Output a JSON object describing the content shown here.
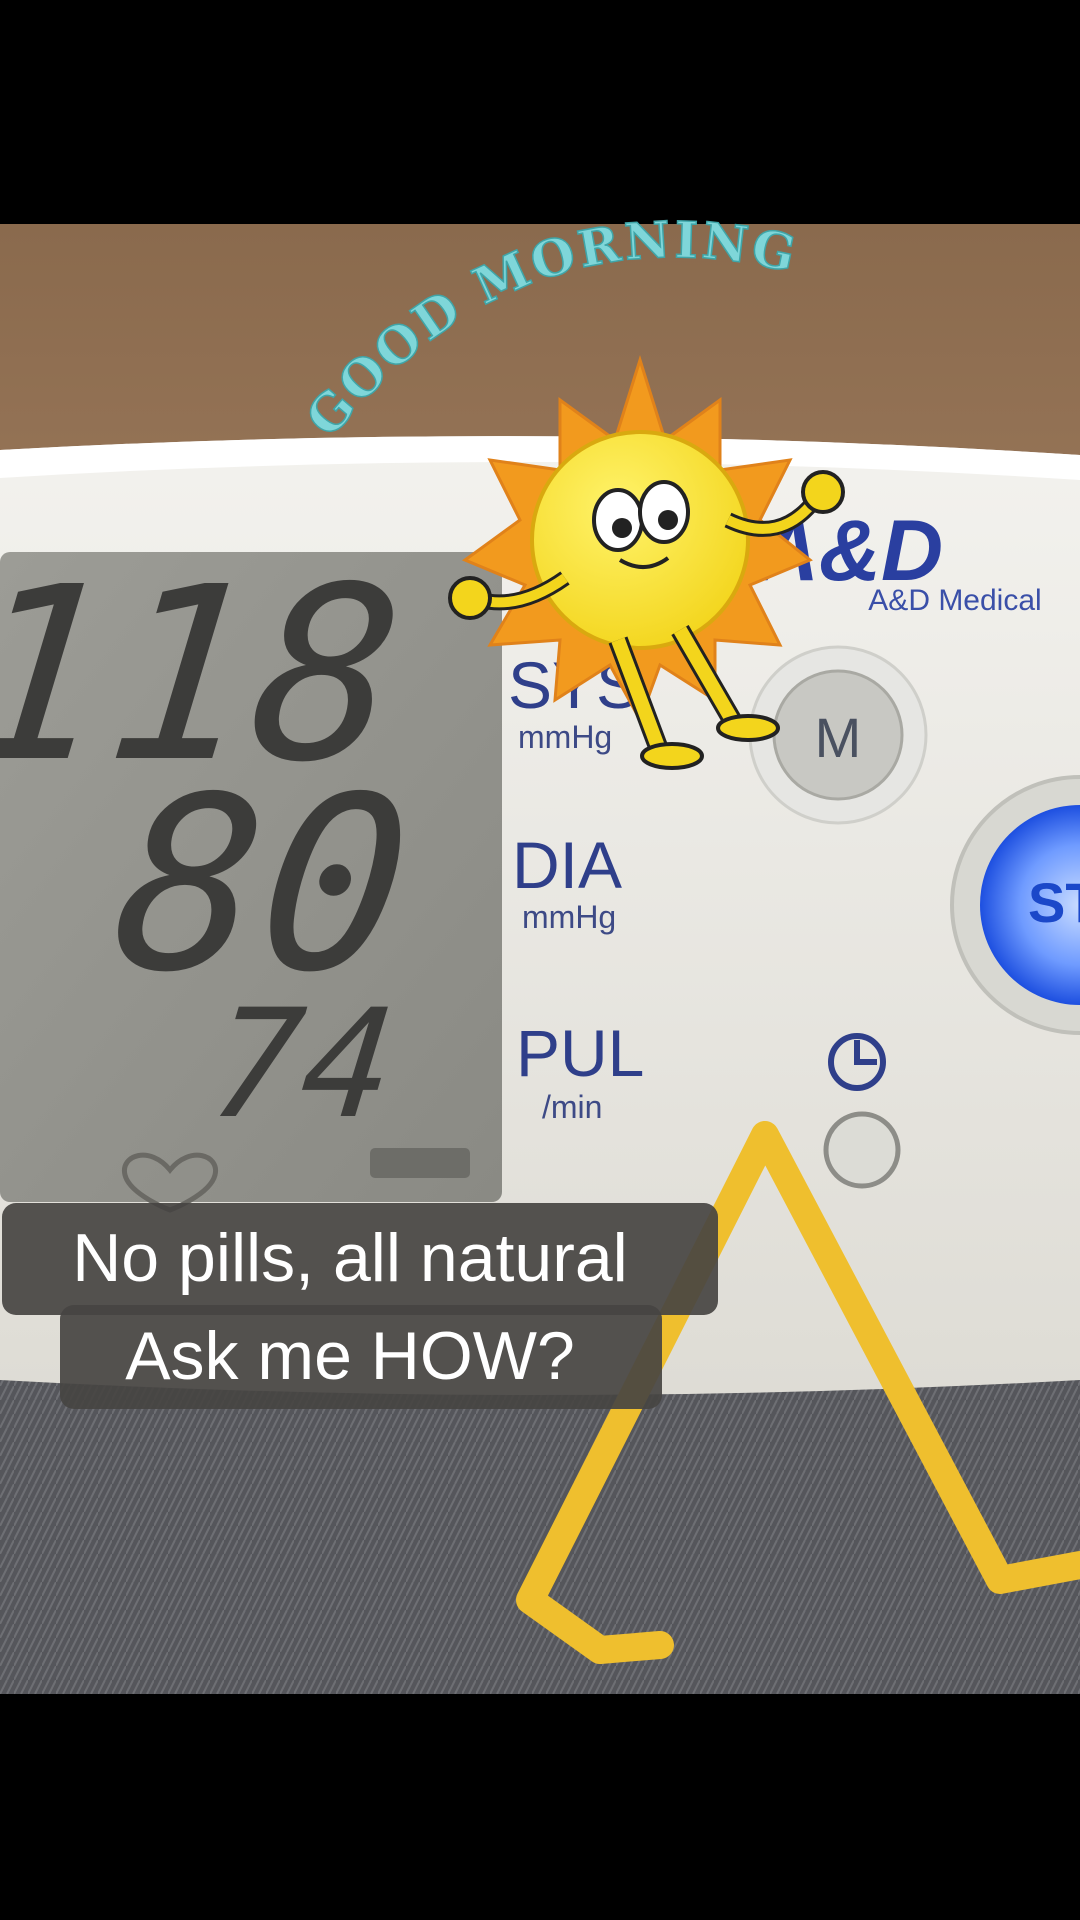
{
  "sticker": {
    "text": "GOOD MORNING"
  },
  "monitor": {
    "brand": "A&D",
    "brand_sub": "A&D Medical",
    "sys_value": "118",
    "dia_value": "80",
    "pul_value": "74",
    "sys_label": "SYS",
    "sys_unit": "mmHg",
    "dia_label": "DIA",
    "dia_unit": "mmHg",
    "pul_label": "PUL",
    "pul_unit": "/min",
    "m_button": "M",
    "start_button": "ST"
  },
  "caption": {
    "line1": "No pills, all natural",
    "line2": "Ask me HOW?"
  },
  "colors": {
    "background": "#000000",
    "sticker_text": "#7fd6d9",
    "sun_body": "#f7e22c",
    "sun_rays": "#f29a1e",
    "arrow": "#efbf2e",
    "label_blue": "#2f3f8a",
    "start_glow": "#2f6cff"
  },
  "icons": [
    "sun-character-icon",
    "timer-icon",
    "heart-icon",
    "arrow-icon"
  ]
}
